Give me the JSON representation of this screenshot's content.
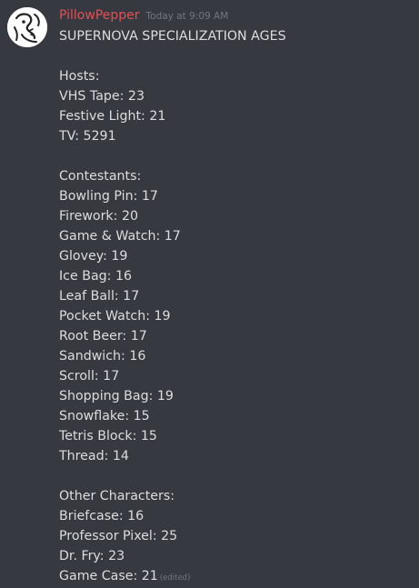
{
  "message": {
    "username": "PillowPepper",
    "timestamp": "Today at 9:09 AM",
    "title": "SUPERNOVA SPECIALIZATION AGES",
    "hosts_heading": "Hosts:",
    "hosts": [
      "VHS Tape: 23",
      "Festive Light: 21",
      "TV: 5291"
    ],
    "contestants_heading": "Contestants:",
    "contestants": [
      "Bowling Pin: 17",
      "Firework: 20",
      "Game & Watch: 17",
      "Glovey: 19",
      "Ice Bag: 16",
      "Leaf Ball: 17",
      "Pocket Watch: 19",
      "Root Beer: 17",
      "Sandwich: 16",
      "Scroll: 17",
      "Shopping Bag: 19",
      "Snowflake: 15",
      "Tetris Block: 15",
      "Thread: 14"
    ],
    "others_heading": "Other Characters:",
    "others": [
      "Briefcase: 16",
      "Professor Pixel: 25",
      "Dr. Fry: 23",
      "Game Case: 21"
    ],
    "edited_label": "(edited)"
  },
  "colors": {
    "background": "#36393f",
    "username": "#e24f55",
    "text": "#dcddde",
    "muted": "#72767d"
  },
  "icons": {
    "avatar": "user-avatar-doodle"
  }
}
